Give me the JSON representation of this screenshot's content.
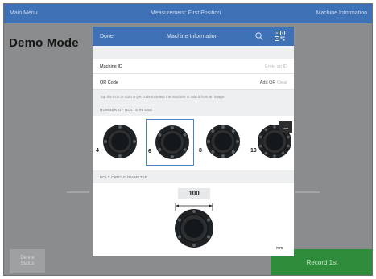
{
  "topbar": {
    "left": "Main Menu",
    "center": "Measurement: First Position",
    "right": "Machine Information"
  },
  "background": {
    "title": "Demo Mode",
    "left_button": [
      "Delete",
      "Status"
    ],
    "right_button": "Record 1st"
  },
  "modal": {
    "done": "Done",
    "title": "Machine Information",
    "icons": {
      "search": "search-icon",
      "qr": "qr-code-icon"
    },
    "machine_id": {
      "label": "Machine ID",
      "value": "Enter an ID"
    },
    "qr_code": {
      "label": "QR Code",
      "value_prefix": "Add QR",
      "value_suffix": "Clear"
    },
    "hint": "Tap the icon to scan a QR code to select the machine or add it from an image.",
    "bolts_section": "NUMBER OF BOLTS IN USE",
    "bolt_options": [
      {
        "number": "4",
        "selected": false
      },
      {
        "number": "6",
        "selected": true
      },
      {
        "number": "8",
        "selected": false
      },
      {
        "number": "10",
        "selected": false
      }
    ],
    "next_arrow": "→",
    "bcd_section": "BOLT CIRCLE DIAMETER",
    "bcd_value": "100",
    "unit": "mm"
  },
  "colors": {
    "header_blue": "#3e71b6",
    "record_green": "#2f8c3b",
    "selected_border": "#4a82c6"
  }
}
